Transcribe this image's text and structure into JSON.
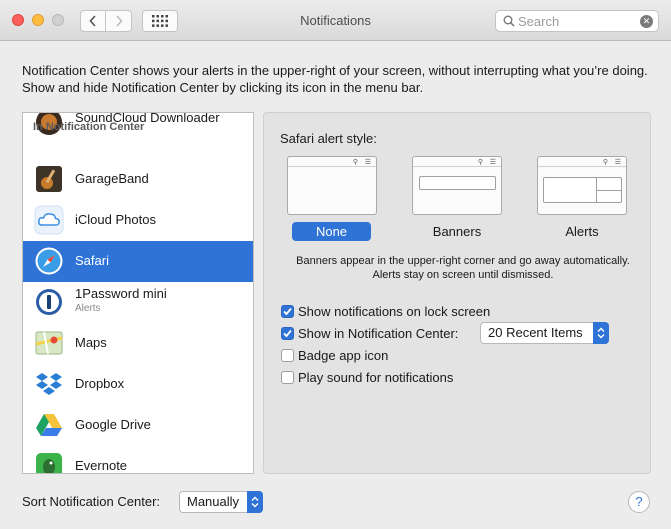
{
  "window": {
    "title": "Notifications",
    "search": {
      "placeholder": "Search",
      "value": ""
    }
  },
  "description": "Notification Center shows your alerts in the upper-right of your screen, without interrupting what you’re doing. Show and hide Notification Center by clicking its icon in the menu bar.",
  "sidebar": {
    "header": "In Notification Center",
    "items": [
      {
        "label": "SoundCloud Downloader",
        "icon": "soundcloud-downloader-icon"
      },
      {
        "label": "GarageBand",
        "icon": "garageband-icon"
      },
      {
        "label": "iCloud Photos",
        "icon": "icloud-photos-icon"
      },
      {
        "label": "Safari",
        "icon": "safari-icon",
        "selected": true
      },
      {
        "label": "1Password mini",
        "sublabel": "Alerts",
        "icon": "1password-icon"
      },
      {
        "label": "Maps",
        "icon": "maps-icon"
      },
      {
        "label": "Dropbox",
        "icon": "dropbox-icon"
      },
      {
        "label": "Google Drive",
        "icon": "google-drive-icon"
      },
      {
        "label": "Evernote",
        "icon": "evernote-icon"
      }
    ]
  },
  "panel": {
    "alert_style_label": "Safari alert style:",
    "styles": [
      {
        "label": "None",
        "selected": true
      },
      {
        "label": "Banners",
        "selected": false
      },
      {
        "label": "Alerts",
        "selected": false
      }
    ],
    "help_text": "Banners appear in the upper-right corner and go away automatically. Alerts stay on screen until dismissed.",
    "options": [
      {
        "label": "Show notifications on lock screen",
        "checked": true
      },
      {
        "label": "Show in Notification Center:",
        "checked": true
      },
      {
        "label": "Badge app icon",
        "checked": false
      },
      {
        "label": "Play sound for notifications",
        "checked": false
      }
    ],
    "recent_items_value": "20 Recent Items"
  },
  "footer": {
    "sort_label": "Sort Notification Center:",
    "sort_value": "Manually",
    "help_button": "?"
  },
  "colors": {
    "accent": "#2f73d6"
  }
}
